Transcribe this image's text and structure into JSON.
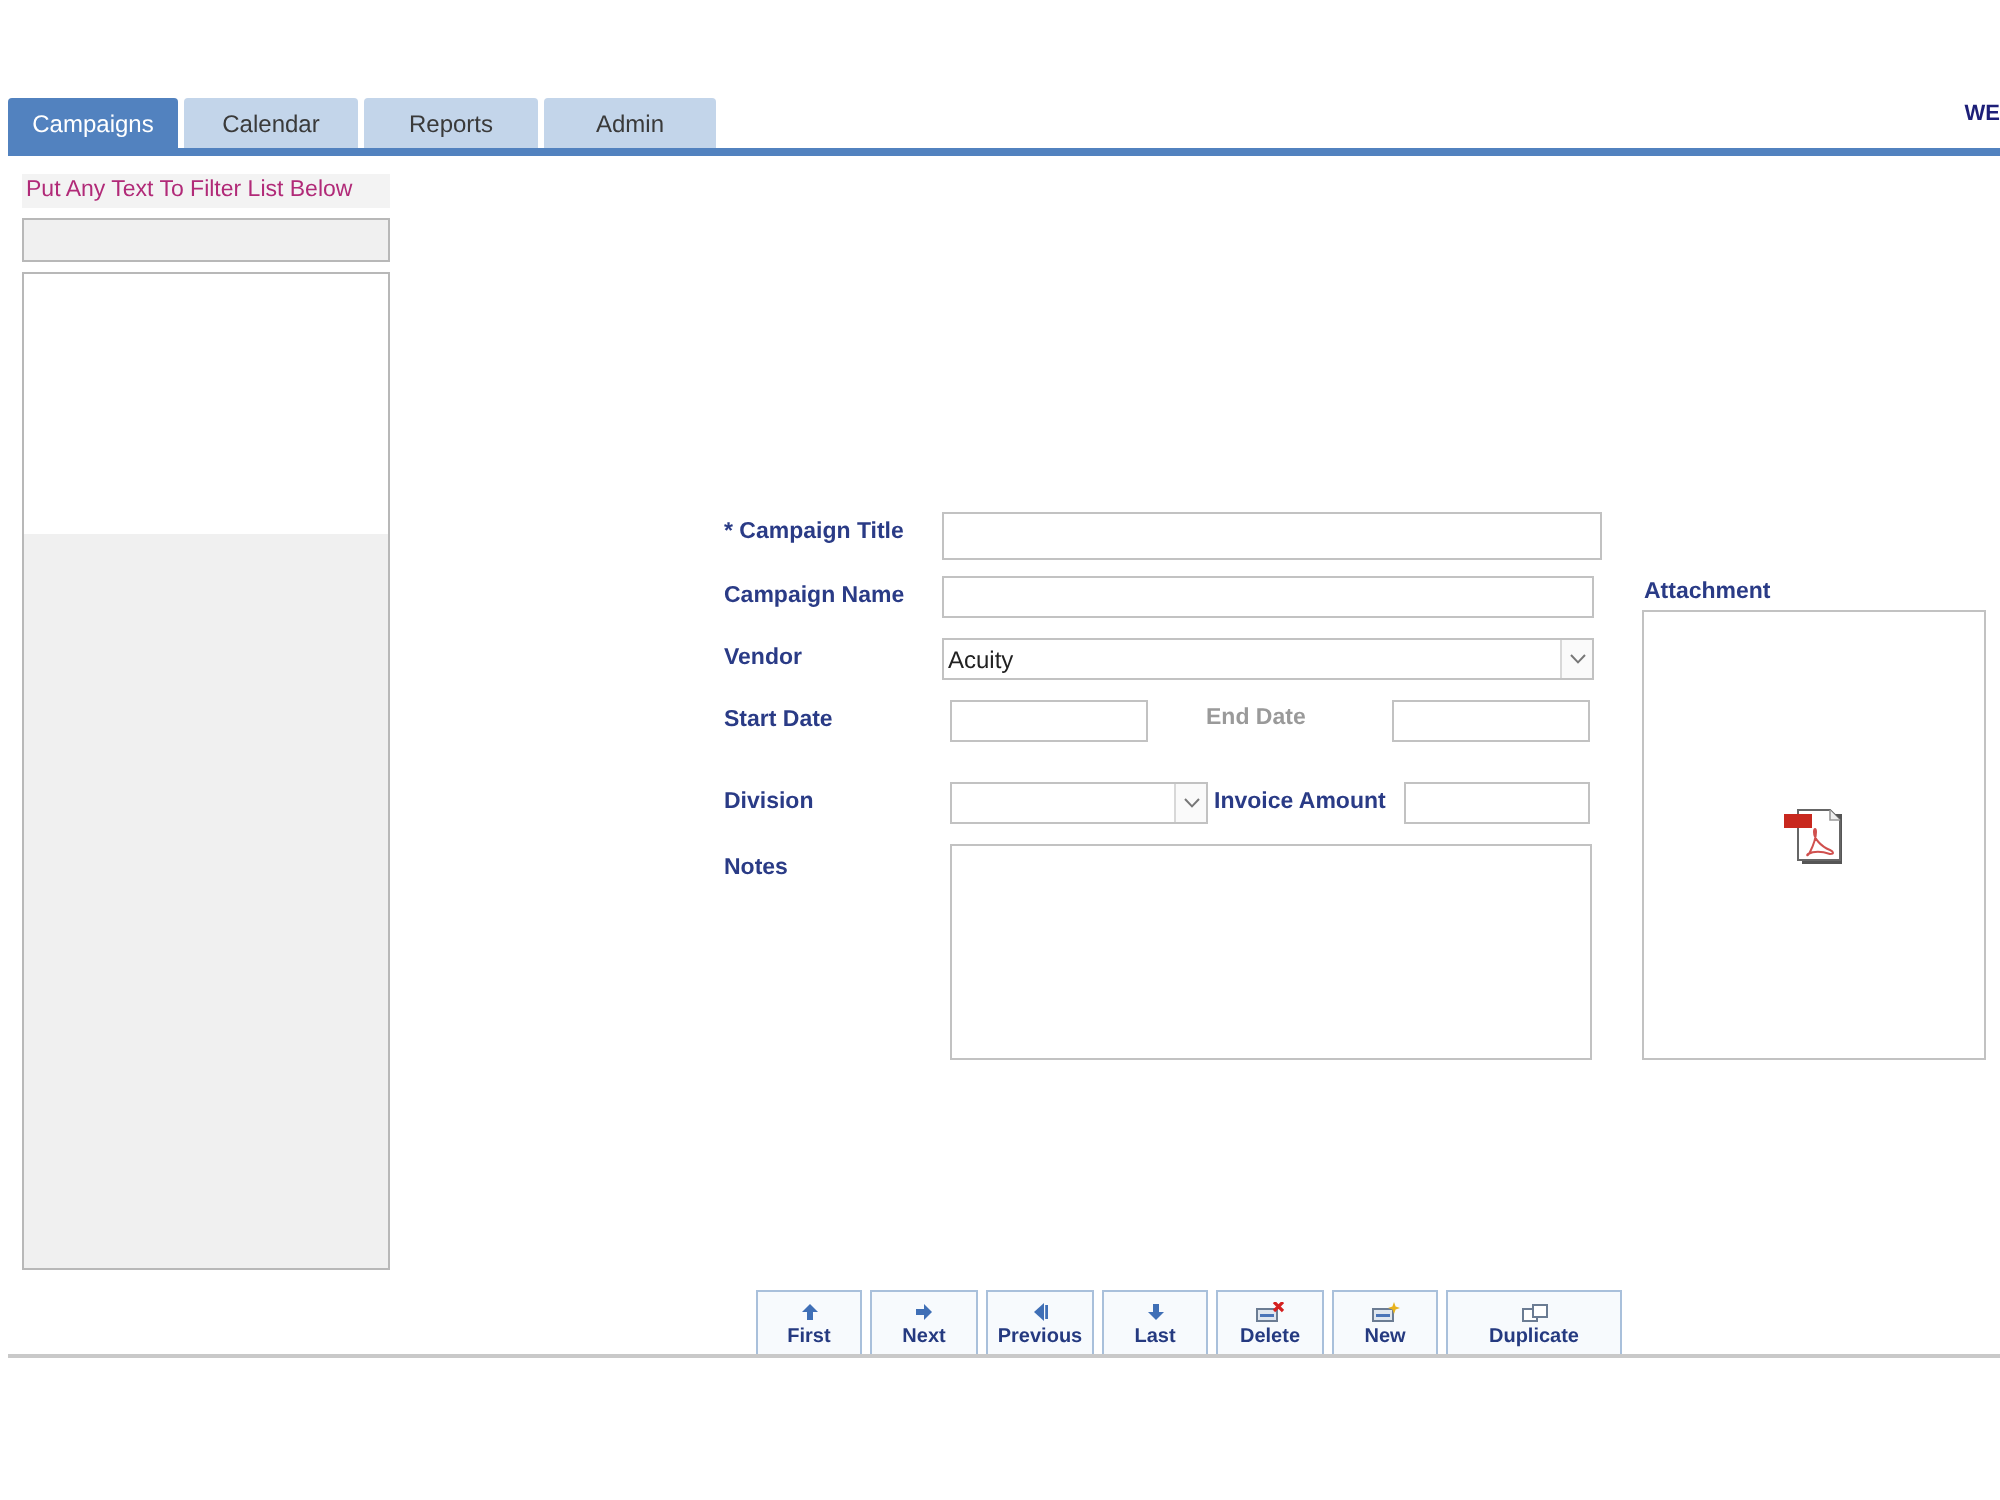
{
  "tabs": [
    {
      "label": "Campaigns",
      "selected": true
    },
    {
      "label": "Calendar",
      "selected": false
    },
    {
      "label": "Reports",
      "selected": false
    },
    {
      "label": "Admin",
      "selected": false
    }
  ],
  "header_right_text": "WE",
  "sidebar": {
    "filter_label": "Put Any Text To Filter List Below"
  },
  "form": {
    "rows": [
      [
        {
          "kind": "text",
          "label": "* Campaign Title",
          "disabled": false
        }
      ],
      [
        {
          "kind": "text",
          "label": "Campaign Name",
          "disabled": false
        }
      ],
      [
        {
          "kind": "dropdown",
          "label": "Vendor",
          "value": "Acuity",
          "disabled": false
        }
      ],
      [
        {
          "kind": "text",
          "label": "Start Date",
          "disabled": false
        },
        {
          "kind": "text",
          "label": "End Date",
          "disabled": true
        }
      ],
      [
        {
          "kind": "dropdown",
          "label": "Division",
          "disabled": false
        },
        {
          "kind": "text",
          "label": "Invoice Amount",
          "disabled": false
        }
      ],
      [
        {
          "kind": "textarea",
          "label": "Notes",
          "disabled": false
        }
      ]
    ],
    "attachment": {
      "label": "Attachment"
    }
  },
  "buttons": [
    {
      "kind": "first",
      "label": "First"
    },
    {
      "kind": "next",
      "label": "Next"
    },
    {
      "kind": "previous",
      "label": "Previous"
    },
    {
      "kind": "last",
      "label": "Last"
    },
    {
      "kind": "delete",
      "label": "Delete"
    },
    {
      "kind": "new",
      "label": "New"
    },
    {
      "kind": "duplicate",
      "label": "Duplicate"
    }
  ]
}
